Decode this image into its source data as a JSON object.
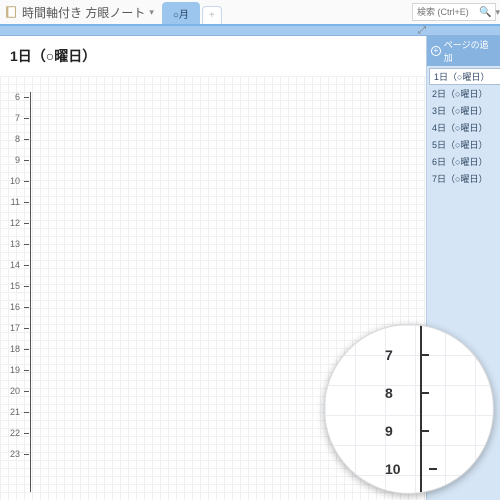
{
  "notebook": {
    "title": "時間軸付き 方眼ノート"
  },
  "tabs": {
    "active": "○月",
    "add": "+"
  },
  "search": {
    "placeholder": "検索 (Ctrl+E)"
  },
  "page": {
    "title": "1日（○曜日）"
  },
  "hours": [
    "6",
    "7",
    "8",
    "9",
    "10",
    "11",
    "12",
    "13",
    "14",
    "15",
    "16",
    "17",
    "18",
    "19",
    "20",
    "21",
    "22",
    "23"
  ],
  "sidepanel": {
    "add_label": "ページの追加",
    "pages": [
      "1日（○曜日）",
      "2日（○曜日）",
      "3日（○曜日）",
      "4日（○曜日）",
      "5日（○曜日）",
      "6日（○曜日）",
      "7日（○曜日）"
    ]
  },
  "magnifier": {
    "hours": [
      "7",
      "8",
      "9",
      "10"
    ]
  }
}
